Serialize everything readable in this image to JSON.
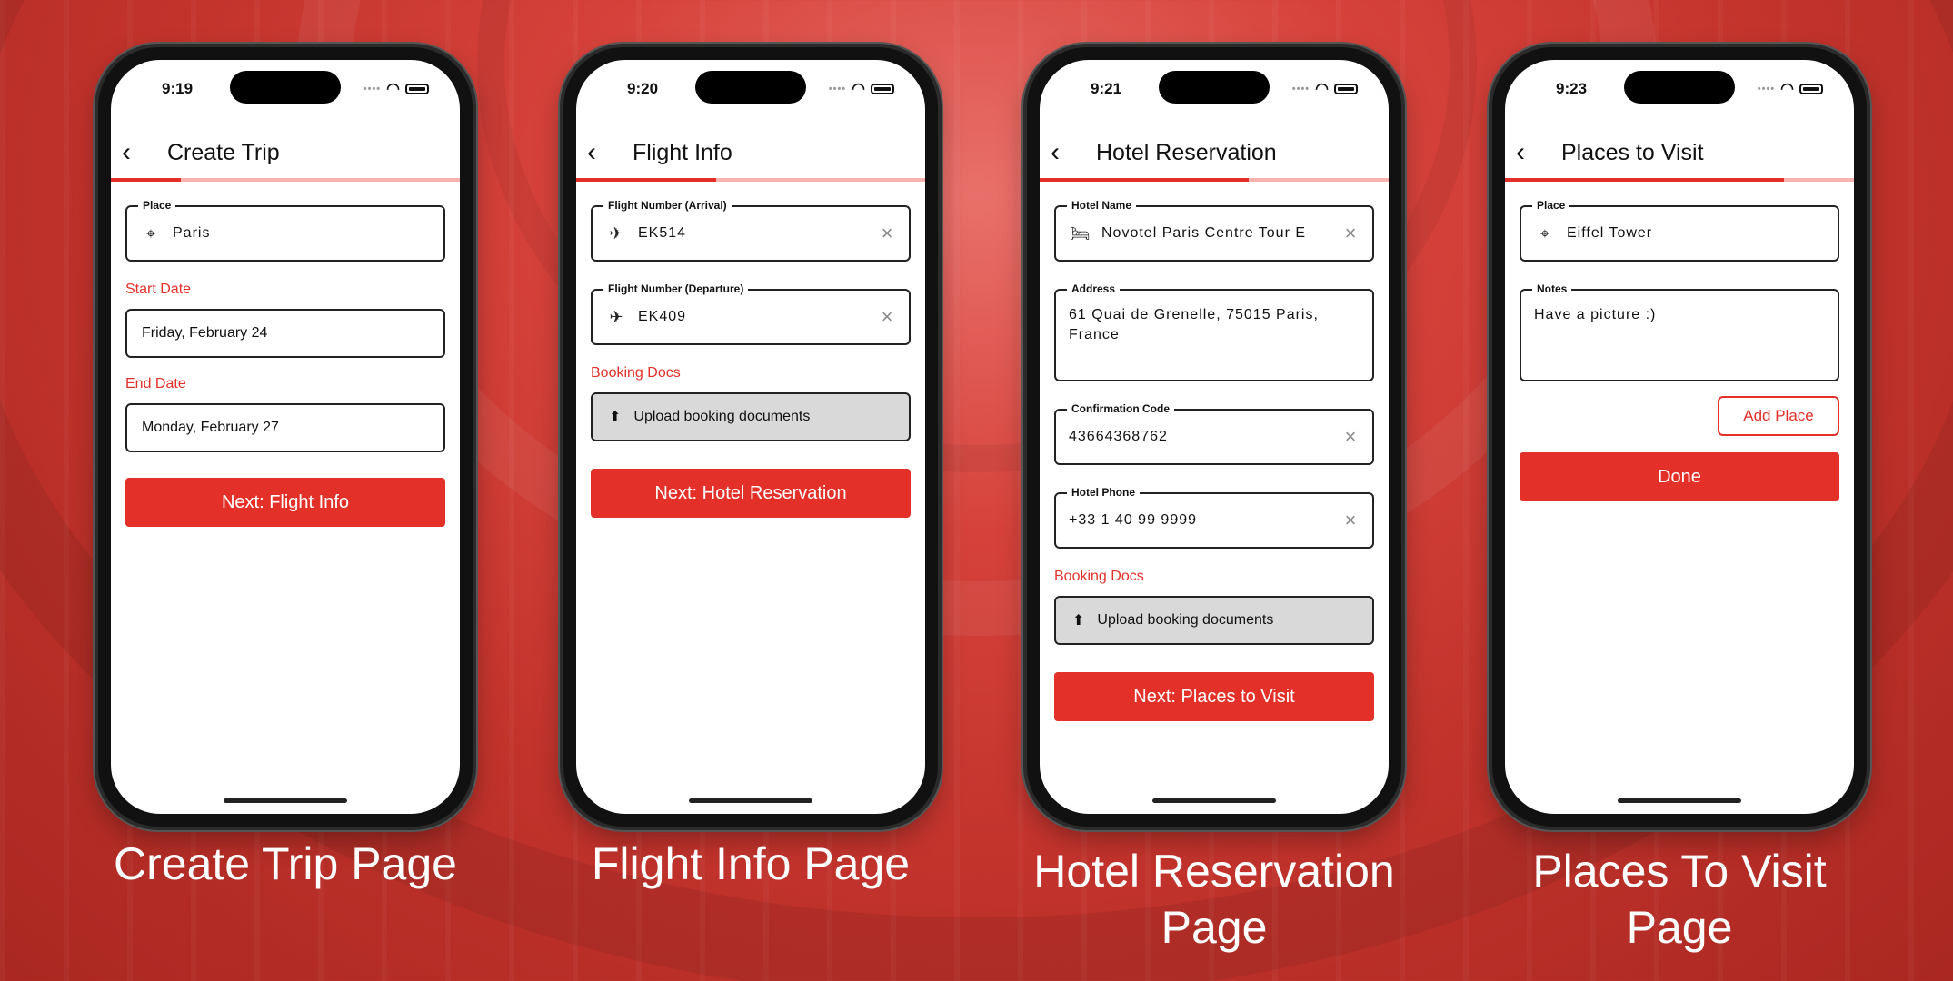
{
  "colors": {
    "accent": "#e3312a",
    "accent_light": "#f6b3b0",
    "upload_bg": "#d9d9d9"
  },
  "phones": [
    {
      "time": "9:19",
      "title": "Create Trip",
      "progress": 0.2,
      "place": {
        "label": "Place",
        "value": "Paris"
      },
      "start_date_label": "Start Date",
      "start_date": "Friday, February 24",
      "end_date_label": "End Date",
      "end_date": "Monday, February 27",
      "next_button": "Next: Flight Info",
      "caption": "Create Trip Page"
    },
    {
      "time": "9:20",
      "title": "Flight Info",
      "progress": 0.4,
      "arrival": {
        "label": "Flight Number (Arrival)",
        "value": "EK514"
      },
      "departure": {
        "label": "Flight Number (Departure)",
        "value": "EK409"
      },
      "docs_label": "Booking Docs",
      "upload_button": "Upload booking documents",
      "next_button": "Next: Hotel Reservation",
      "caption": "Flight Info Page"
    },
    {
      "time": "9:21",
      "title": "Hotel Reservation",
      "progress": 0.6,
      "hotel_name": {
        "label": "Hotel Name",
        "value": "Novotel Paris Centre Tour E"
      },
      "address": {
        "label": "Address",
        "value": "61 Quai de Grenelle, 75015 Paris, France"
      },
      "confirmation": {
        "label": "Confirmation Code",
        "value": "43664368762"
      },
      "phone": {
        "label": "Hotel Phone",
        "value": "+33 1 40 99 9999"
      },
      "docs_label": "Booking Docs",
      "upload_button": "Upload booking documents",
      "next_button": "Next: Places to Visit",
      "caption_line1": "Hotel Reservation",
      "caption_line2": "Page"
    },
    {
      "time": "9:23",
      "title": "Places to Visit",
      "progress": 0.8,
      "place": {
        "label": "Place",
        "value": "Eiffel Tower"
      },
      "notes": {
        "label": "Notes",
        "value": "Have a picture :)"
      },
      "add_button": "Add Place",
      "done_button": "Done",
      "caption_line1": "Places To Visit",
      "caption_line2": "Page"
    }
  ],
  "icons": {
    "back": "chevron-left-icon",
    "place": "location-pin-icon",
    "flight": "airplane-icon",
    "hotel": "bed-icon",
    "clear": "close-icon",
    "upload": "upload-icon"
  }
}
